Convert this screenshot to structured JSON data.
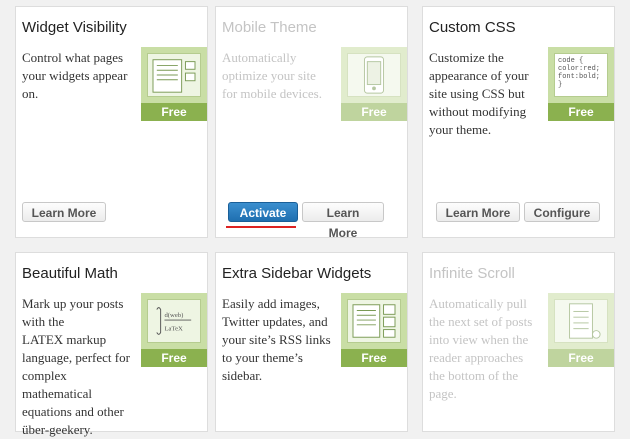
{
  "cards": [
    {
      "title": "Widget Visibility",
      "desc": "Control what pages your widgets appear on.",
      "badge": "Free",
      "buttons": [
        "Learn More"
      ]
    },
    {
      "title": "Mobile Theme",
      "desc": "Automatically optimize your site for mobile devices.",
      "badge": "Free",
      "buttons": [
        "Activate",
        "Learn More"
      ]
    },
    {
      "title": "Custom CSS",
      "desc": "Customize the appearance of your site using CSS but without modifying your theme.",
      "badge": "Free",
      "buttons": [
        "Learn More",
        "Configure"
      ],
      "thumb_text": "code { color:red; font:bold; }"
    },
    {
      "title": "Beautiful Math",
      "desc_lines": [
        "Mark up your posts with the",
        "LATEX markup language, perfect for complex mathematical equations and other über-geekery."
      ],
      "badge": "Free"
    },
    {
      "title": "Extra Sidebar Widgets",
      "desc": "Easily add images, Twitter updates, and your site’s RSS links to your theme’s sidebar.",
      "badge": "Free"
    },
    {
      "title": "Infinite Scroll",
      "desc": "Automatically pull the next set of posts into view when the reader approaches the bottom of the page.",
      "badge": "Free"
    }
  ],
  "colors": {
    "free_badge": "#8bb14f",
    "thumb_bg": "#c9dea5",
    "activate": "#2a7ab9",
    "highlight": "#dd2222"
  }
}
